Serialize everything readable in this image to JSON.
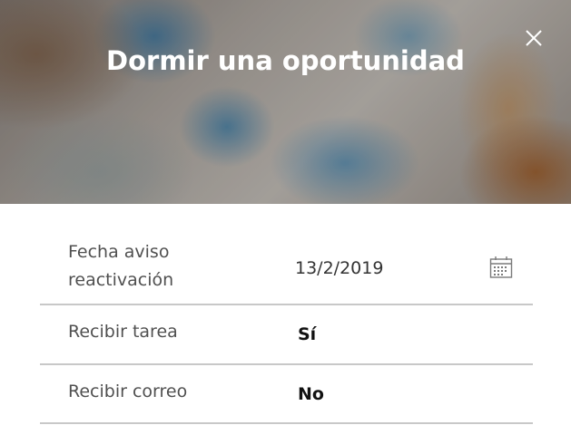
{
  "dialog": {
    "title": "Dormir una oportunidad",
    "close_icon": "close-icon"
  },
  "fields": {
    "reactivation_date": {
      "label": "Fecha aviso reactivación",
      "value": "13/2/2019",
      "icon": "calendar-icon"
    },
    "receive_task": {
      "label": "Recibir tarea",
      "value": "Sí"
    },
    "receive_email": {
      "label": "Recibir correo",
      "value": "No"
    }
  },
  "colors": {
    "title_text": "#ffffff",
    "label_text": "#505050",
    "divider": "#c8c8c8",
    "value_text": "#111111"
  }
}
